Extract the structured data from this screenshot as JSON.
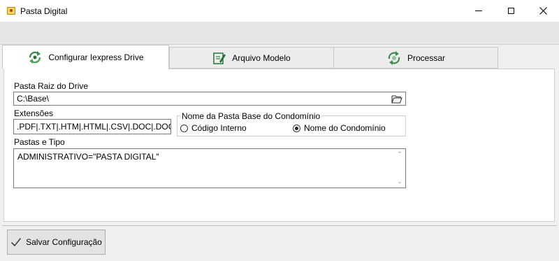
{
  "window": {
    "title": "Pasta Digital",
    "icon": "folder-star-icon",
    "controls": [
      "minimize-icon",
      "maximize-icon",
      "close-icon"
    ]
  },
  "tabs": [
    {
      "label": "Configurar Iexpress Drive",
      "icon": "refresh-cycle-icon",
      "active": true
    },
    {
      "label": "Arquivo Modelo",
      "icon": "edit-document-icon",
      "active": false
    },
    {
      "label": "Processar",
      "icon": "process-cycle-icon",
      "active": false
    }
  ],
  "form": {
    "pasta_raiz": {
      "label": "Pasta Raiz do Drive",
      "value": "C:\\Base\\",
      "button_icon": "open-folder-icon"
    },
    "extensoes": {
      "label": "Extensões",
      "value": ".PDF|.TXT|.HTM|.HTML|.CSV|.DOC|.DOCX"
    },
    "nome_pasta_base": {
      "legend": "Nome da Pasta Base do Condomínio",
      "options": [
        {
          "label": "Código Interno",
          "selected": false
        },
        {
          "label": "Nome do Condomínio",
          "selected": true
        }
      ]
    },
    "pastas_tipo": {
      "label": "Pastas e Tipo",
      "value": "ADMINISTRATIVO=\"PASTA DIGITAL\""
    }
  },
  "actions": {
    "save_label": "Salvar Configuração",
    "save_icon": "checkmark-icon"
  },
  "colors": {
    "tab_icon_green": "#3a8a4a",
    "active_tab_bg": "#ffffff"
  }
}
